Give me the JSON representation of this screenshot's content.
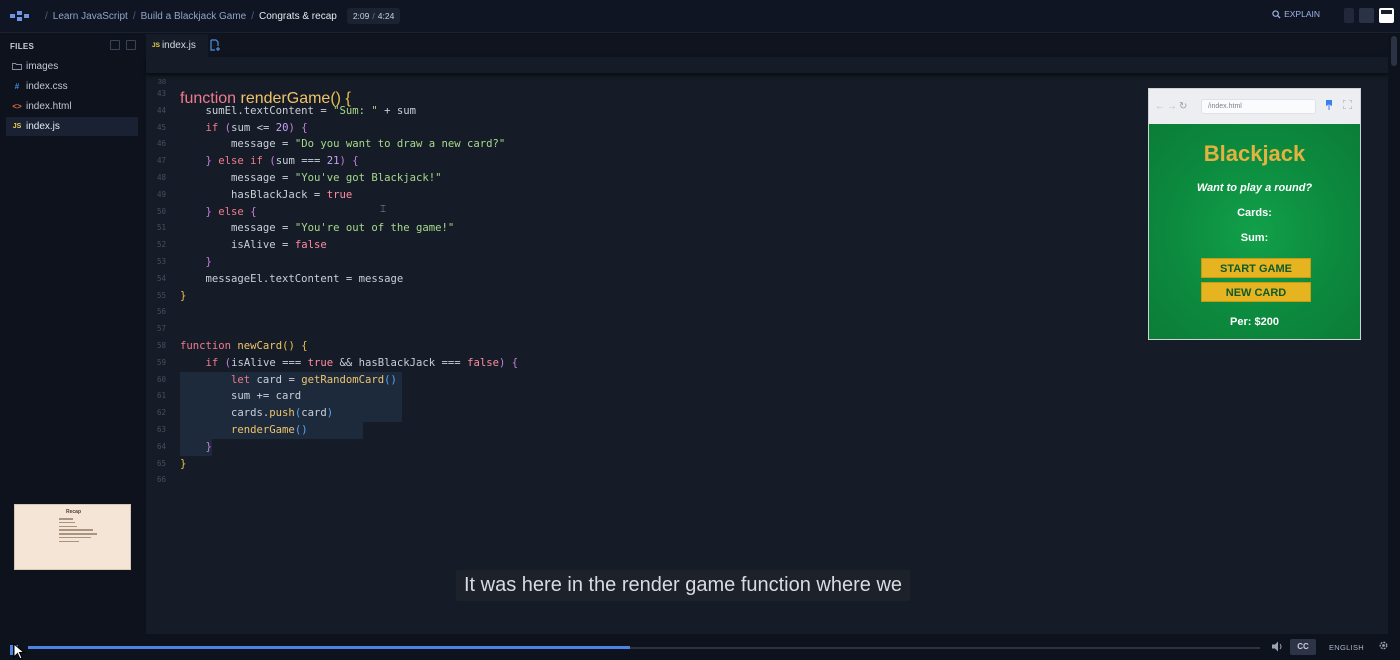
{
  "topbar": {
    "breadcrumbs": [
      "Learn JavaScript",
      "Build a Blackjack Game",
      "Congrats & recap"
    ],
    "time_current": "2:09",
    "time_total": "4:24",
    "explain_label": "EXPLAIN"
  },
  "sidebar": {
    "heading": "FILES",
    "files": [
      {
        "name": "images",
        "icon": "folder-icon"
      },
      {
        "name": "index.css",
        "icon": "css-file-icon",
        "glyph": "#"
      },
      {
        "name": "index.html",
        "icon": "html-file-icon",
        "glyph": "<>"
      },
      {
        "name": "index.js",
        "icon": "js-file-icon",
        "glyph": "JS",
        "active": true
      }
    ],
    "thumbnail_title": "Recap"
  },
  "editor": {
    "tab_label": "index.js",
    "tab_glyph": "JS",
    "sticky_line_number": "38",
    "code_lines": [
      {
        "n": "43",
        "tokens": [
          [
            "plain",
            ""
          ]
        ]
      },
      {
        "n": "44",
        "tokens": [
          [
            "plain",
            "    sumEl.textContent = "
          ],
          [
            "str",
            "\"Sum: \""
          ],
          [
            "plain",
            " + sum"
          ]
        ]
      },
      {
        "n": "45",
        "tokens": [
          [
            "kw",
            "    if"
          ],
          [
            "plain",
            " "
          ],
          [
            "br2",
            "("
          ],
          [
            "plain",
            "sum <= "
          ],
          [
            "num",
            "20"
          ],
          [
            "br2",
            ")"
          ],
          [
            "plain",
            " "
          ],
          [
            "br2",
            "{"
          ]
        ]
      },
      {
        "n": "46",
        "tokens": [
          [
            "plain",
            "        message = "
          ],
          [
            "str",
            "\"Do you want to draw a new card?\""
          ]
        ]
      },
      {
        "n": "47",
        "tokens": [
          [
            "plain",
            "    "
          ],
          [
            "br2",
            "}"
          ],
          [
            "kw",
            " else if"
          ],
          [
            "plain",
            " "
          ],
          [
            "br2",
            "("
          ],
          [
            "plain",
            "sum === "
          ],
          [
            "num",
            "21"
          ],
          [
            "br2",
            ")"
          ],
          [
            "plain",
            " "
          ],
          [
            "br2",
            "{"
          ]
        ]
      },
      {
        "n": "48",
        "tokens": [
          [
            "plain",
            "        message = "
          ],
          [
            "str",
            "\"You've got Blackjack!\""
          ]
        ]
      },
      {
        "n": "49",
        "tokens": [
          [
            "plain",
            "        hasBlackJack = "
          ],
          [
            "boo",
            "true"
          ]
        ]
      },
      {
        "n": "50",
        "tokens": [
          [
            "plain",
            "    "
          ],
          [
            "br2",
            "}"
          ],
          [
            "kw",
            " else"
          ],
          [
            "plain",
            " "
          ],
          [
            "br2",
            "{"
          ]
        ]
      },
      {
        "n": "51",
        "tokens": [
          [
            "plain",
            "        message = "
          ],
          [
            "str",
            "\"You're out of the game!\""
          ]
        ]
      },
      {
        "n": "52",
        "tokens": [
          [
            "plain",
            "        isAlive = "
          ],
          [
            "boo",
            "false"
          ]
        ]
      },
      {
        "n": "53",
        "tokens": [
          [
            "plain",
            "    "
          ],
          [
            "br2",
            "}"
          ]
        ]
      },
      {
        "n": "54",
        "tokens": [
          [
            "plain",
            "    messageEl.textContent = message"
          ]
        ]
      },
      {
        "n": "55",
        "tokens": [
          [
            "br1",
            "}"
          ]
        ]
      },
      {
        "n": "56",
        "tokens": [
          [
            "plain",
            ""
          ]
        ]
      },
      {
        "n": "57",
        "tokens": [
          [
            "plain",
            ""
          ]
        ]
      },
      {
        "n": "58",
        "tokens": [
          [
            "kw",
            "function"
          ],
          [
            "plain",
            " "
          ],
          [
            "fn",
            "newCard"
          ],
          [
            "br1",
            "()"
          ],
          [
            "plain",
            " "
          ],
          [
            "br1",
            "{"
          ]
        ]
      },
      {
        "n": "59",
        "tokens": [
          [
            "kw",
            "    if"
          ],
          [
            "plain",
            " "
          ],
          [
            "br2",
            "("
          ],
          [
            "plain",
            "isAlive === "
          ],
          [
            "boo",
            "true"
          ],
          [
            "plain",
            " && hasBlackJack === "
          ],
          [
            "boo",
            "false"
          ],
          [
            "br2",
            ")"
          ],
          [
            "plain",
            " "
          ],
          [
            "br2",
            "{"
          ]
        ]
      },
      {
        "n": "60",
        "tokens": [
          [
            "kw",
            "        let"
          ],
          [
            "plain",
            " card = "
          ],
          [
            "fn",
            "getRandomCard"
          ],
          [
            "br3",
            "()"
          ]
        ],
        "hl": 222
      },
      {
        "n": "61",
        "tokens": [
          [
            "plain",
            "        sum += card"
          ]
        ],
        "hl": 222
      },
      {
        "n": "62",
        "tokens": [
          [
            "plain",
            "        cards."
          ],
          [
            "fn",
            "push"
          ],
          [
            "br3",
            "("
          ],
          [
            "plain",
            "card"
          ],
          [
            "br3",
            ")"
          ]
        ],
        "hl": 222
      },
      {
        "n": "63",
        "tokens": [
          [
            "plain",
            "        "
          ],
          [
            "fn",
            "renderGame"
          ],
          [
            "br3",
            "()"
          ]
        ],
        "hl": 183
      },
      {
        "n": "64",
        "tokens": [
          [
            "plain",
            "    "
          ],
          [
            "br2",
            "}"
          ]
        ],
        "hl": 32
      },
      {
        "n": "65",
        "tokens": [
          [
            "br1",
            "}"
          ]
        ]
      },
      {
        "n": "66",
        "tokens": [
          [
            "plain",
            ""
          ]
        ]
      }
    ],
    "sticky_tokens": [
      [
        "kw",
        "function"
      ],
      [
        "plain",
        " "
      ],
      [
        "fn",
        "renderGame"
      ],
      [
        "br1",
        "()"
      ],
      [
        "plain",
        " "
      ],
      [
        "br1",
        "{"
      ]
    ]
  },
  "preview": {
    "url": "/index.html",
    "title": "Blackjack",
    "message": "Want to play a round?",
    "cards_label": "Cards:",
    "sum_label": "Sum:",
    "start_button": "START GAME",
    "new_card_button": "NEW CARD",
    "player": "Per: $200"
  },
  "subtitle": "It was here in the render game function where we",
  "player": {
    "progress": 0.489,
    "cc_label": "CC",
    "language": "ENGLISH"
  },
  "colors": {
    "accent": "#4e83e6",
    "felt": "#0f8a3c",
    "button_gold": "#e5b420"
  }
}
